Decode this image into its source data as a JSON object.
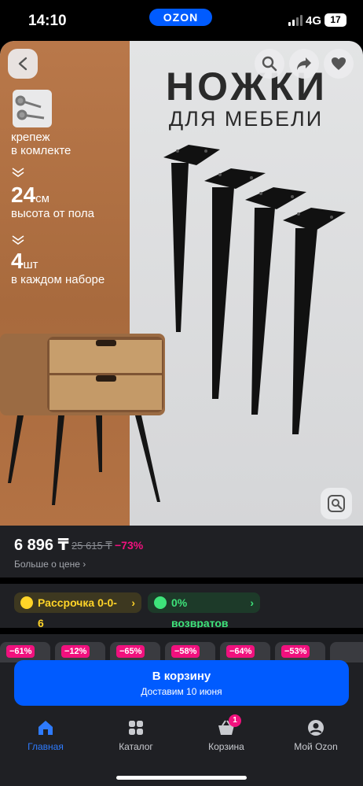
{
  "status_bar": {
    "time": "14:10",
    "app_pill": "OZON",
    "network": "4G",
    "battery": "17"
  },
  "hero": {
    "title_line1": "НОЖКИ",
    "title_line2": "ДЛЯ МЕБЕЛИ",
    "features": [
      {
        "big": "",
        "unit": "",
        "text_line1": "крепеж",
        "text_line2": "в комлекте"
      },
      {
        "big": "24",
        "unit": "см",
        "text_line1": "высота от пола",
        "text_line2": ""
      },
      {
        "big": "4",
        "unit": "шт",
        "text_line1": "в каждом наборе",
        "text_line2": ""
      }
    ],
    "icons": [
      "back-icon",
      "search-icon",
      "share-icon",
      "heart-icon",
      "lens-search-icon"
    ]
  },
  "price": {
    "current": "6 896 ₸",
    "old": "25 615 ₸",
    "discount": "−73%",
    "more_link": "Больше о цене"
  },
  "chips": {
    "installment": "Рассрочка 0-0-6",
    "returns": "0% возвратов"
  },
  "related_strip": {
    "badges": [
      "−61%",
      "−12%",
      "−65%",
      "−58%",
      "−64%",
      "−53%"
    ]
  },
  "cart_button": {
    "label": "В корзину",
    "sub": "Доставим 10 июня"
  },
  "tabbar": {
    "items": [
      {
        "label": "Главная",
        "icon": "home-icon",
        "active": true
      },
      {
        "label": "Каталог",
        "icon": "catalog-icon",
        "active": false
      },
      {
        "label": "Корзина",
        "icon": "basket-icon",
        "active": false,
        "badge": "1"
      },
      {
        "label": "Мой Ozon",
        "icon": "profile-icon",
        "active": false
      }
    ]
  },
  "colors": {
    "accent": "#005bff",
    "discount": "#f1117e",
    "installment": "#ffd428",
    "returns": "#3ee37a"
  }
}
